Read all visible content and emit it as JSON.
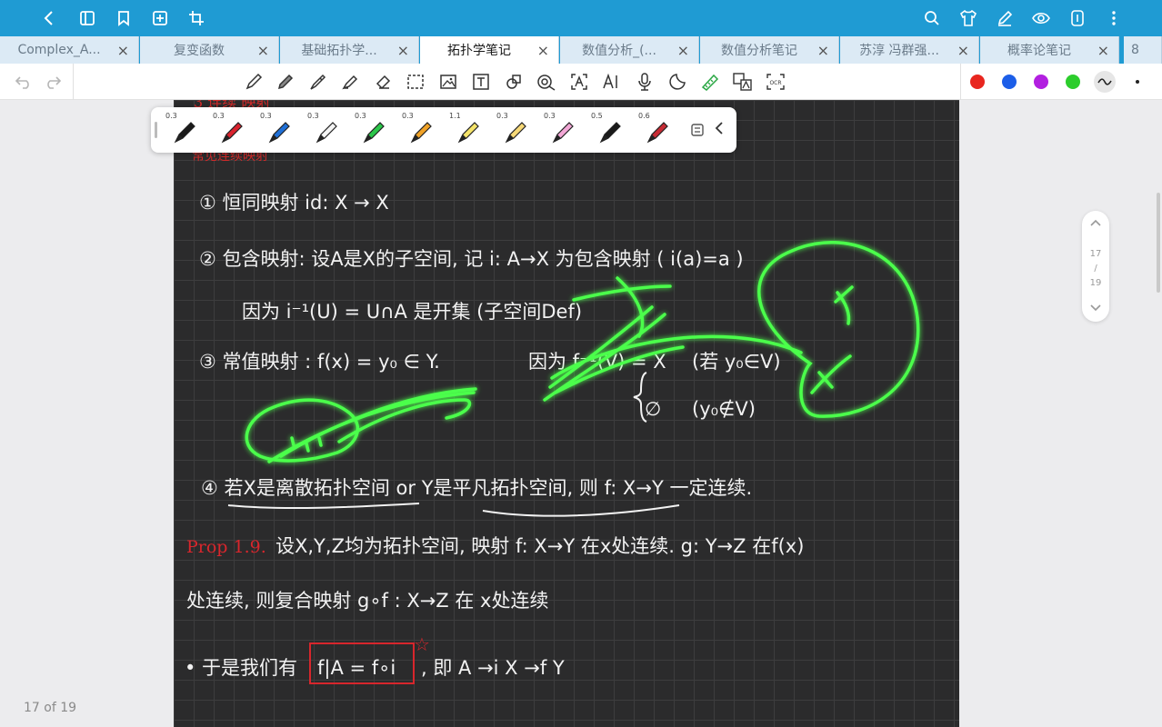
{
  "tabs": [
    {
      "label": "Complex_A..."
    },
    {
      "label": "复变函数"
    },
    {
      "label": "基础拓扑学..."
    },
    {
      "label": "拓扑学笔记",
      "active": true
    },
    {
      "label": "数值分析_(..."
    },
    {
      "label": "数值分析笔记"
    },
    {
      "label": "苏淳 冯群强..."
    },
    {
      "label": "概率论笔记"
    },
    {
      "label": "8"
    }
  ],
  "tab_close_glyph": "×",
  "pen_tray": {
    "pens": [
      {
        "size": "0.3",
        "color": "#1a1a1a"
      },
      {
        "size": "0.3",
        "color": "#d9232e"
      },
      {
        "size": "0.3",
        "color": "#1f6fd6"
      },
      {
        "size": "0.3",
        "color": "#f4f4f4"
      },
      {
        "size": "0.3",
        "color": "#2bc64a"
      },
      {
        "size": "0.3",
        "color": "#f0a227"
      },
      {
        "size": "1.1",
        "color": "#f5e46a"
      },
      {
        "size": "0.3",
        "color": "#f7d978"
      },
      {
        "size": "0.3",
        "color": "#f3a7d6"
      },
      {
        "size": "0.5",
        "color": "#1a1a1a"
      },
      {
        "size": "0.6",
        "color": "#c62b34"
      }
    ]
  },
  "colors": {
    "red": "#e8261f",
    "blue": "#1c5ee8",
    "purple": "#b21fe0",
    "green": "#2ccd2c"
  },
  "page_nav": {
    "current": "17",
    "sep": "/",
    "total": "19"
  },
  "page_indicator": "17 of 19",
  "note": {
    "line1": "① 恒同映射 id: X → X",
    "line2": "② 包含映射: 设A是X的子空间, 记 i: A→X 为包含映射 ( i(a)=a )",
    "line3": "因为 i⁻¹(U) = U∩A 是开集 (子空间Def)",
    "line4a": "③ 常值映射 : f(x) = y₀ ∈ Y.",
    "line4b": "因为 f⁻¹(V) = X",
    "line4c": "(若 y₀∈V)",
    "line5a": "∅",
    "line5b": "(y₀∉V)",
    "line6": "④ 若X是离散拓扑空间 or Y是平凡拓扑空间, 则 f: X→Y 一定连续.",
    "prop_label": "Prop 1.9.",
    "line7": "设X,Y,Z均为拓扑空间, 映射 f: X→Y 在x处连续. g: Y→Z 在f(x)",
    "line8": "处连续, 则复合映射 g∘f : X→Z 在 x处连续",
    "line9a": "• 于是我们有",
    "line9b": "f|A = f∘i",
    "line9c": ", 即 A →i X →f Y",
    "star": "☆"
  }
}
